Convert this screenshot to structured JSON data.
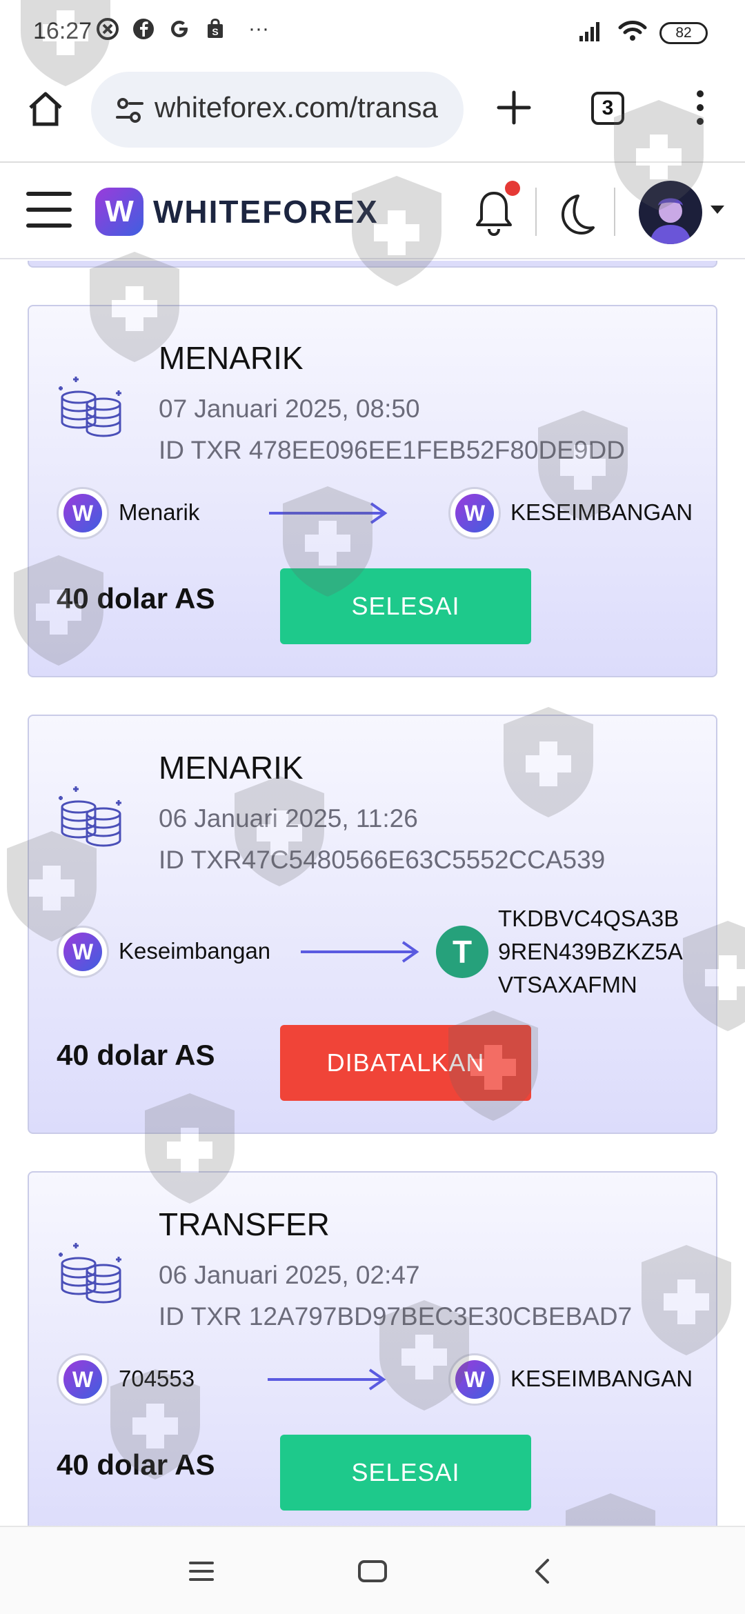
{
  "status_bar": {
    "time": "16:27",
    "battery": "82",
    "more": "···"
  },
  "browser": {
    "url": "whiteforex.com/transa",
    "tab_count": "3"
  },
  "header": {
    "logo_text": "WHITEFOREX",
    "logo_letter": "W"
  },
  "transactions": [
    {
      "type": "MENARIK",
      "date": "07 Januari 2025, 08:50",
      "txid": "ID TXR 478EE096EE1FEB52F80DE9DD",
      "from_label": "Menarik",
      "to_label": "KESEIMBANGAN",
      "amount": "40 dolar AS",
      "status": "SELESAI"
    },
    {
      "type": "MENARIK",
      "date": "06 Januari 2025, 11:26",
      "txid": "ID TXR47C5480566E63C5552CCA539",
      "from_label": "Keseimbangan",
      "to_label_lines": [
        "TKDBVC4QSA3B",
        "9REN439BZKZ5A",
        "VTSAXAFMN"
      ],
      "amount": "40 dolar AS",
      "status": "DIBATALKAN"
    },
    {
      "type": "TRANSFER",
      "date": "06 Januari 2025, 02:47",
      "txid": "ID TXR 12A797BD97BEC3E30CBEBAD7",
      "from_label": "704553",
      "to_label": "KESEIMBANGAN",
      "amount": "40 dolar AS",
      "status": "SELESAI"
    }
  ],
  "colors": {
    "success": "#1ec98b",
    "cancel": "#f04438",
    "arrow": "#5a5ae0",
    "card_bg": "#dcdcfb"
  },
  "icons": [
    "home-icon",
    "tune-icon",
    "plus-icon",
    "kebab-menu-icon",
    "hamburger-icon",
    "bell-icon",
    "moon-icon",
    "coins-icon",
    "arrow-right-icon",
    "tether-icon"
  ]
}
